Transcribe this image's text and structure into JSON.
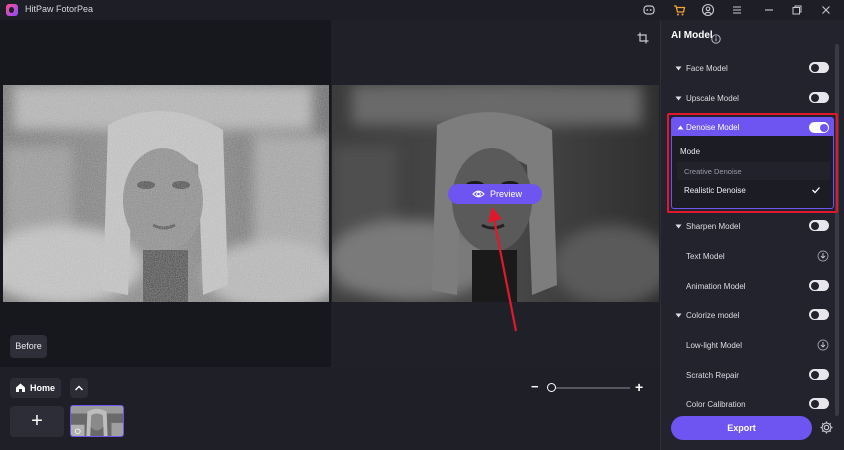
{
  "app": {
    "title": "HitPaw FotorPea"
  },
  "colors": {
    "accent": "#6e54f0",
    "highlight": "#e0182d",
    "background": "#1b1b24",
    "panel": "#23232d"
  },
  "titlebar": {
    "icons": [
      "discord-icon",
      "cart-icon",
      "account-icon",
      "menu-icon",
      "minimize-icon",
      "maximize-icon",
      "close-icon"
    ]
  },
  "canvas": {
    "before_label": "Before",
    "preview_label": "Preview"
  },
  "bottom": {
    "home_label": "Home",
    "add_label": "+",
    "zoom_minus": "−",
    "zoom_plus": "+",
    "zoom_level": 0.0
  },
  "panel": {
    "title": "AI Model",
    "models": [
      {
        "label": "Face Model",
        "control": "toggle",
        "state": "off",
        "expandable": true
      },
      {
        "label": "Upscale Model",
        "control": "toggle",
        "state": "off",
        "expandable": true
      },
      {
        "label": "Denoise Model",
        "control": "toggle",
        "state": "on",
        "expandable": true,
        "expanded": true
      },
      {
        "label": "Sharpen Model",
        "control": "toggle",
        "state": "off",
        "expandable": true
      },
      {
        "label": "Text Model",
        "control": "download",
        "expandable": false
      },
      {
        "label": "Animation Model",
        "control": "toggle",
        "state": "off",
        "expandable": false
      },
      {
        "label": "Colorize model",
        "control": "toggle",
        "state": "off",
        "expandable": true
      },
      {
        "label": "Low-light Model",
        "control": "download",
        "expandable": false
      },
      {
        "label": "Scratch Repair",
        "control": "toggle",
        "state": "off",
        "expandable": false
      },
      {
        "label": "Color Calibration",
        "control": "toggle",
        "state": "off",
        "expandable": false
      }
    ],
    "denoise": {
      "mode_label": "Mode",
      "options": [
        {
          "label": "Creative Denoise",
          "selected": false
        },
        {
          "label": "Realistic Denoise",
          "selected": true
        }
      ]
    },
    "export_label": "Export"
  }
}
